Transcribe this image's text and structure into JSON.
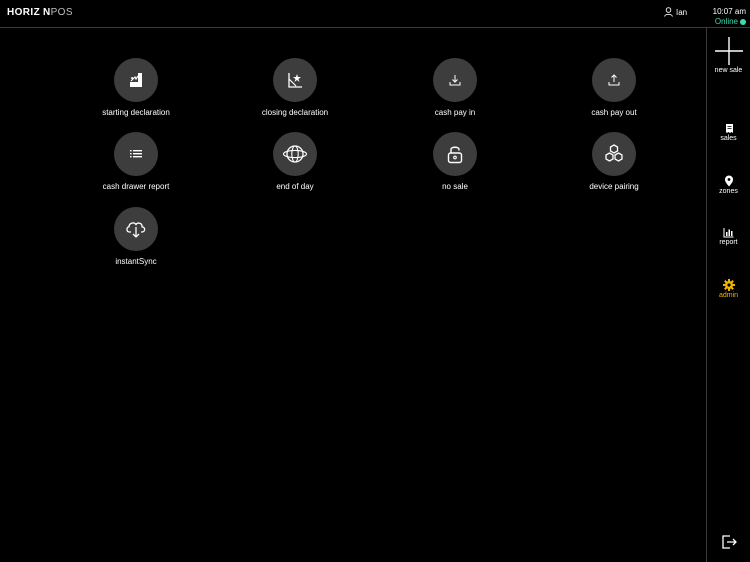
{
  "header": {
    "logo_bold": "HORIZ",
    "logo_mid": "N",
    "logo_light": "POS",
    "user_name": "Ian",
    "time": "10:07 am",
    "status": "Online"
  },
  "tiles": [
    {
      "label": "starting declaration",
      "icon": "starting-declaration-icon"
    },
    {
      "label": "closing declaration",
      "icon": "closing-declaration-icon"
    },
    {
      "label": "cash pay in",
      "icon": "cash-pay-in-icon"
    },
    {
      "label": "cash pay out",
      "icon": "cash-pay-out-icon"
    },
    {
      "label": "cash drawer report",
      "icon": "list-icon"
    },
    {
      "label": "end of day",
      "icon": "orbit-icon"
    },
    {
      "label": "no sale",
      "icon": "unlock-icon"
    },
    {
      "label": "device pairing",
      "icon": "hexagons-icon"
    },
    {
      "label": "instantSync",
      "icon": "cloud-download-icon"
    }
  ],
  "sidebar": {
    "new_sale": "new sale",
    "sales": "sales",
    "zones": "zones",
    "report": "report",
    "admin": "admin"
  },
  "colors": {
    "accent": "#f0b400",
    "online": "#3fd9b0",
    "tile_bg": "#3d3d3d"
  }
}
